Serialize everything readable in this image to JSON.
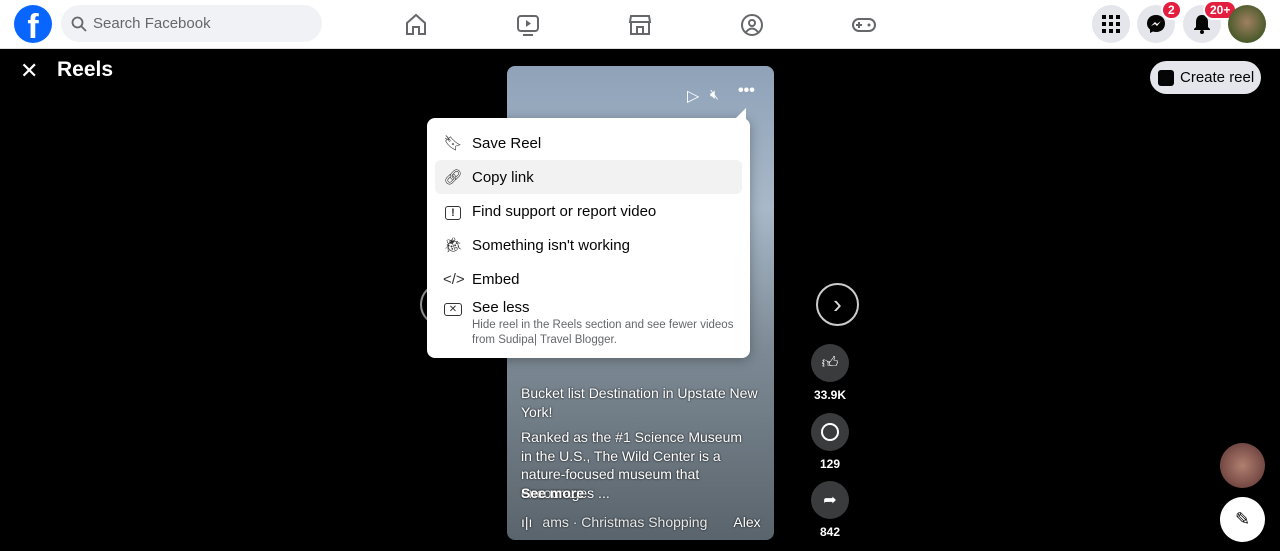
{
  "search": {
    "placeholder": "Search Facebook"
  },
  "badges": {
    "messenger": "2",
    "notifications": "20+"
  },
  "page": {
    "title": "Reels",
    "create_reel": "Create reel"
  },
  "menu": {
    "items": [
      {
        "icon": "bookmark-icon",
        "label": "Save Reel"
      },
      {
        "icon": "link-icon",
        "label": "Copy link"
      },
      {
        "icon": "report-icon",
        "label": "Find support or report video"
      },
      {
        "icon": "bug-icon",
        "label": "Something isn't working"
      },
      {
        "icon": "code-icon",
        "label": "Embed"
      },
      {
        "icon": "close-box-icon",
        "label": "See less",
        "description": "Hide reel in the Reels section and see fewer videos from Sudipa| Travel Blogger."
      }
    ]
  },
  "reel": {
    "title": "Bucket list Destination in Upstate New York!",
    "description": "Ranked as the #1 Science Museum in the U.S., The Wild Center is a nature-focused museum that encourages ...",
    "see_more": "See more",
    "music": "ams · Christmas Shopping",
    "music_artist": "Alex"
  },
  "actions": {
    "likes": "33.9K",
    "comments": "129",
    "shares": "842"
  }
}
